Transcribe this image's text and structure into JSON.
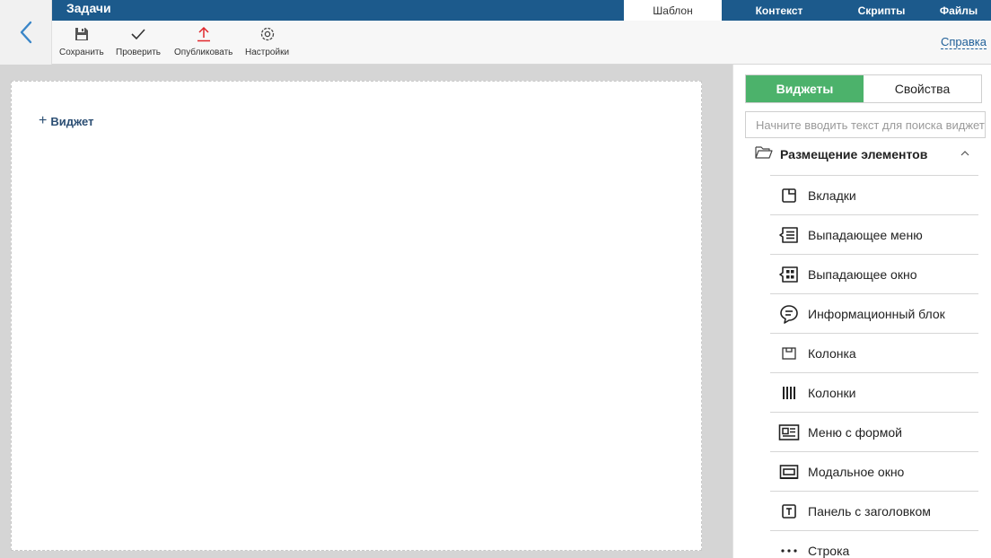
{
  "header": {
    "title": "Задачи",
    "tabs": [
      {
        "label": "Шаблон",
        "active": true
      },
      {
        "label": "Контекст",
        "active": false
      },
      {
        "label": "Скрипты",
        "active": false
      },
      {
        "label": "Файлы",
        "active": false
      }
    ]
  },
  "toolbar": {
    "save_label": "Сохранить",
    "check_label": "Проверить",
    "publish_label": "Опубликовать",
    "settings_label": "Настройки",
    "help_label": "Справка"
  },
  "canvas": {
    "add_widget_label": "Виджет"
  },
  "panel": {
    "tab_widgets": "Виджеты",
    "tab_properties": "Свойства",
    "search_placeholder": "Начните вводить текст для поиска виджета",
    "group_label": "Размещение элементов",
    "items": [
      {
        "label": "Вкладки",
        "icon": "tabs-icon"
      },
      {
        "label": "Выпадающее меню",
        "icon": "dropdown-menu-icon"
      },
      {
        "label": "Выпадающее окно",
        "icon": "dropdown-window-icon"
      },
      {
        "label": "Информационный блок",
        "icon": "info-block-icon"
      },
      {
        "label": "Колонка",
        "icon": "column-icon"
      },
      {
        "label": "Колонки",
        "icon": "columns-icon"
      },
      {
        "label": "Меню с формой",
        "icon": "menu-form-icon"
      },
      {
        "label": "Модальное окно",
        "icon": "modal-window-icon"
      },
      {
        "label": "Панель с заголовком",
        "icon": "titled-panel-icon"
      },
      {
        "label": "Строка",
        "icon": "row-icon"
      }
    ]
  },
  "colors": {
    "header_blue": "#1c5a8c",
    "accent_green": "#4cb26b",
    "link_blue": "#1f5f98",
    "publish_red": "#e0262b"
  }
}
